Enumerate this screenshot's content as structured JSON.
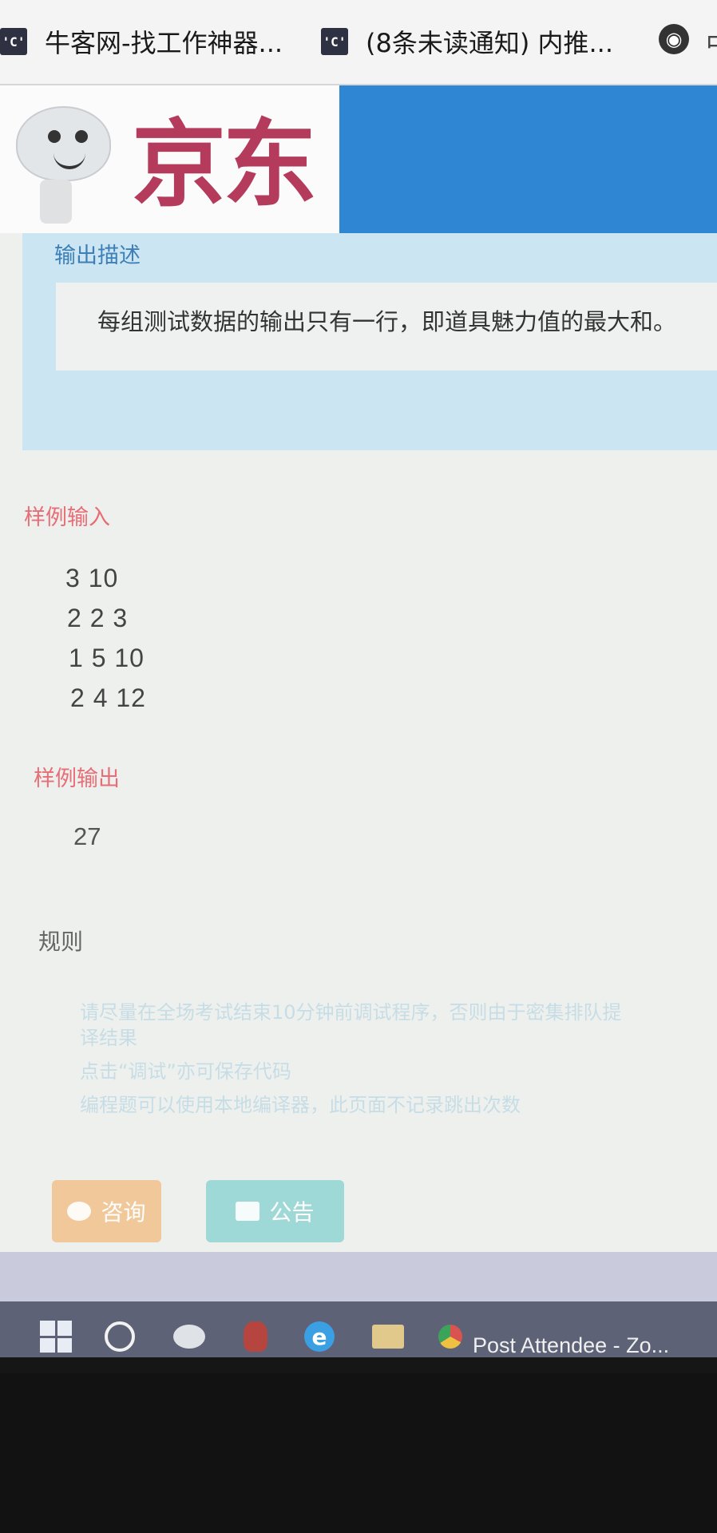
{
  "browser": {
    "tabs": [
      {
        "icon": "nowcoder-tab-icon",
        "icon_text": "'C'",
        "label": "牛客网-找工作神器..."
      },
      {
        "icon": "nowcoder-tab-icon",
        "icon_text": "'C'",
        "label": "(8条未读通知) 内推..."
      }
    ],
    "third_tab_cut": "中"
  },
  "header": {
    "logo_text": "京东"
  },
  "problem": {
    "output_desc_title": "输出描述",
    "output_desc_text": "每组测试数据的输出只有一行，即道具魅力值的最大和。"
  },
  "sample_input": {
    "title": "样例输入",
    "lines": [
      "3 10",
      "2 2 3",
      "1 5 10",
      "2 4 12"
    ]
  },
  "sample_output": {
    "title": "样例输出",
    "value": "27"
  },
  "rules": {
    "title": "规则",
    "items": [
      "请尽量在全场考试结束10分钟前调试程序，否则由于密集排队提",
      "译结果",
      "点击“调试”亦可保存代码",
      "编程题可以使用本地编译器，此页面不记录跳出次数"
    ]
  },
  "buttons": {
    "consult": "咨询",
    "notice": "公告"
  },
  "taskbar": {
    "active_window": "Post Attendee - Zo..."
  },
  "colors": {
    "jd_red": "#b53b5d",
    "banner_blue": "#2f86d2",
    "section_red": "#e76e77"
  }
}
